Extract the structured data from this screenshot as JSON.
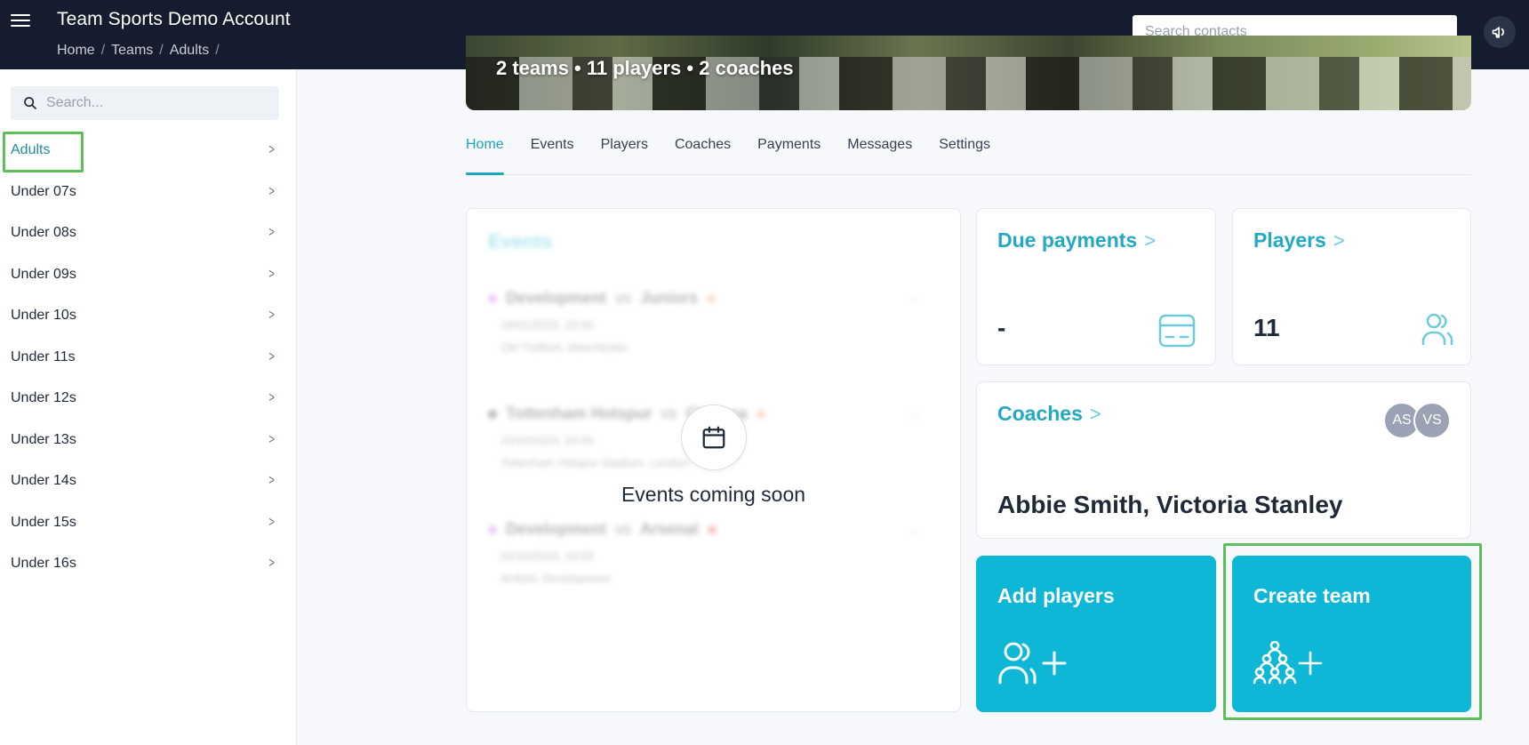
{
  "header": {
    "account_title": "Team Sports Demo Account",
    "breadcrumb": [
      "Home",
      "Teams",
      "Adults"
    ],
    "search_placeholder": "Search contacts"
  },
  "sidebar": {
    "search_placeholder": "Search...",
    "items": [
      {
        "label": "Adults",
        "active": true
      },
      {
        "label": "Under 07s"
      },
      {
        "label": "Under 08s"
      },
      {
        "label": "Under 09s"
      },
      {
        "label": "Under 10s"
      },
      {
        "label": "Under 11s"
      },
      {
        "label": "Under 12s"
      },
      {
        "label": "Under 13s"
      },
      {
        "label": "Under 14s"
      },
      {
        "label": "Under 15s"
      },
      {
        "label": "Under 16s"
      }
    ],
    "chevron": ">"
  },
  "hero": {
    "subtitle": "2 teams • 11 players • 2 coaches"
  },
  "tabs": [
    {
      "label": "Home",
      "active": true
    },
    {
      "label": "Events"
    },
    {
      "label": "Players"
    },
    {
      "label": "Coaches"
    },
    {
      "label": "Payments"
    },
    {
      "label": "Messages"
    },
    {
      "label": "Settings"
    }
  ],
  "events_card": {
    "title": "Events",
    "coming_soon": "Events coming soon",
    "placeholder_events": [
      {
        "team": "Development",
        "vs": "vs",
        "opponent": "Juniors",
        "date": "18/01/2023, 20:00",
        "venue": "Old Trafford, Manchester"
      },
      {
        "team": "Tottenham Hotspur",
        "vs": "vs",
        "opponent": "Chelsea",
        "date": "23/10/2023, 20:00",
        "venue": "Tottenham Hotspur Stadium, London"
      },
      {
        "team": "Development",
        "vs": "vs",
        "opponent": "Arsenal",
        "date": "02/10/2023, 18:00",
        "venue": "Anfield, Development"
      }
    ]
  },
  "due_payments": {
    "title": "Due payments",
    "value": "-"
  },
  "players": {
    "title": "Players",
    "value": "11"
  },
  "coaches": {
    "title": "Coaches",
    "names": "Abbie Smith, Victoria Stanley",
    "avatars": [
      "AS",
      "VS"
    ]
  },
  "actions": {
    "add_players": "Add players",
    "create_team": "Create team"
  },
  "colors": {
    "accent": "#22a9c4",
    "action_bg": "#0fb7d6",
    "topbar": "#141c2e",
    "highlight": "#5cbf5a"
  }
}
